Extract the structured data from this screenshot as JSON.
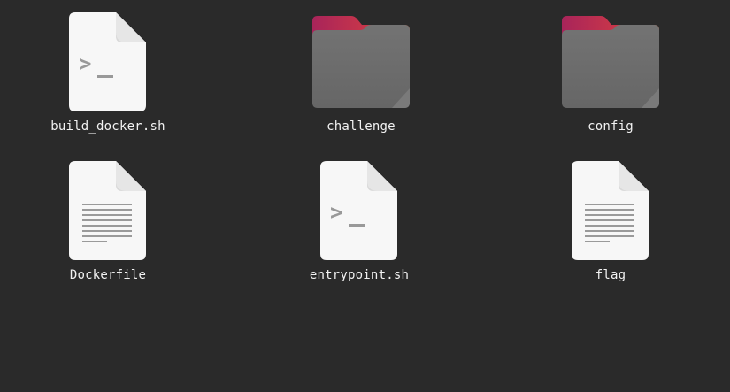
{
  "files": [
    {
      "name": "build_docker.sh",
      "icon": "script-file-icon",
      "type": "script"
    },
    {
      "name": "challenge",
      "icon": "folder-icon",
      "type": "folder"
    },
    {
      "name": "config",
      "icon": "folder-icon",
      "type": "folder"
    },
    {
      "name": "Dockerfile",
      "icon": "text-file-icon",
      "type": "text"
    },
    {
      "name": "entrypoint.sh",
      "icon": "script-file-icon",
      "type": "script"
    },
    {
      "name": "flag",
      "icon": "text-file-icon",
      "type": "text"
    }
  ],
  "colors": {
    "background": "#2a2a2a",
    "label": "#f2f2f2",
    "folder_body": "#6b6b6b",
    "folder_tab_start": "#a8245a",
    "folder_tab_end": "#e9541e",
    "document": "#f7f7f7",
    "document_lines": "#9a9a9a"
  }
}
